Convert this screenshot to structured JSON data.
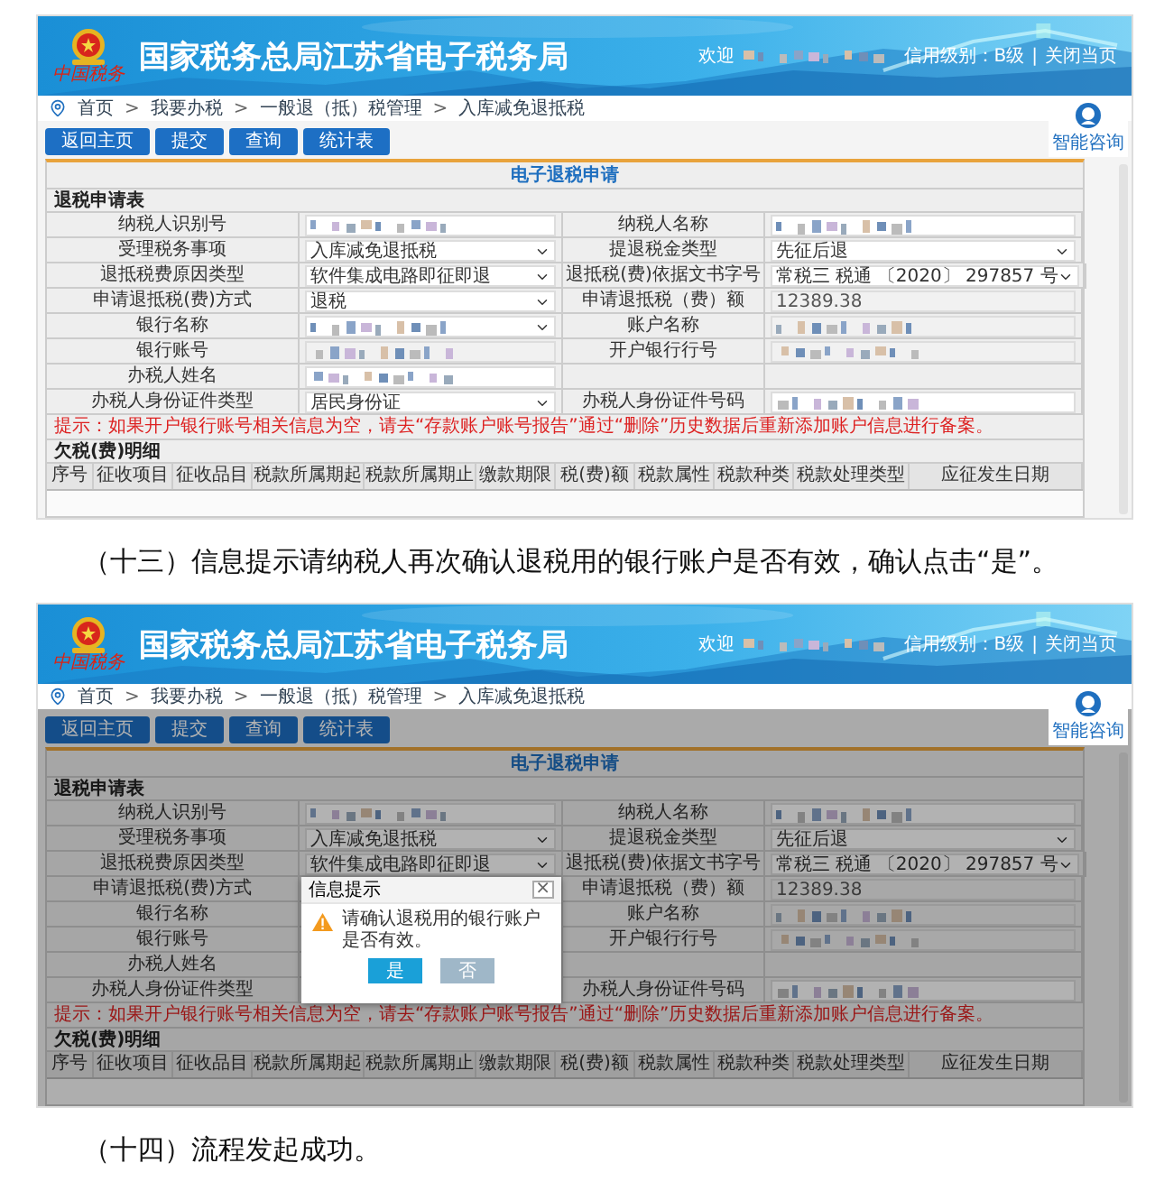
{
  "blocks": [
    {
      "kind": "screen",
      "header": {
        "title": "国家税务总局江苏省电子税务局",
        "logo_caption": "中国税务",
        "welcome": "欢迎",
        "credit": "信用级别：B级",
        "divider": "|",
        "close": "关闭当页"
      },
      "breadcrumb": {
        "separator": ">",
        "items": [
          "首页",
          "我要办税",
          "一般退（抵）税管理",
          "入库减免退抵税"
        ]
      },
      "assistant": "智能咨询",
      "buttons": [
        "返回主页",
        "提交",
        "查询",
        "统计表"
      ],
      "panel_title": "电子退税申请",
      "section_title": "退税申请表",
      "form": [
        {
          "label": "纳税人识别号",
          "field": {
            "kind": "redacted"
          },
          "label2": "纳税人名称",
          "field2": {
            "kind": "redacted"
          }
        },
        {
          "label": "受理税务事项",
          "field": {
            "kind": "select",
            "value": "入库减免退抵税"
          },
          "label2": "提退税金类型",
          "field2": {
            "kind": "select",
            "value": "先征后退"
          }
        },
        {
          "label": "退抵税费原因类型",
          "field": {
            "kind": "select",
            "value": "软件集成电路即征即退"
          },
          "label2": "退抵税(费)依据文书字号",
          "field2": {
            "kind": "select",
            "value": "常税三 税通 〔2020〕 297857 号"
          }
        },
        {
          "label": "申请退抵税(费)方式",
          "field": {
            "kind": "select",
            "value": "退税"
          },
          "label2": "申请退抵税（费）额",
          "field2": {
            "kind": "readonly",
            "value": "12389.38"
          }
        },
        {
          "label": "银行名称",
          "field": {
            "kind": "redacted_select"
          },
          "label2": "账户名称",
          "field2": {
            "kind": "redacted_readonly"
          }
        },
        {
          "label": "银行账号",
          "field": {
            "kind": "redacted_readonly"
          },
          "label2": "开户银行行号",
          "field2": {
            "kind": "redacted_readonly"
          }
        },
        {
          "label": "办税人姓名",
          "field": {
            "kind": "redacted"
          }
        },
        {
          "label": "办税人身份证件类型",
          "field": {
            "kind": "select",
            "value": "居民身份证"
          },
          "label2": "办税人身份证件号码",
          "field2": {
            "kind": "redacted"
          }
        }
      ],
      "hint": "提示：如果开户银行账号相关信息为空，请去“存款账户账号报告”通过“删除”历史数据后重新添加账户信息进行备案。",
      "table_title": "欠税(费)明细",
      "columns": [
        "序号",
        "征收项目",
        "征收品目",
        "税款所属期起",
        "税款所属期止",
        "缴款期限",
        "税(费)额",
        "税款属性",
        "税款种类",
        "税款处理类型",
        "应征发生日期"
      ]
    },
    {
      "kind": "caption",
      "text": "（十三）信息提示请纳税人再次确认退税用的银行账户是否有效，确认点击“是”。"
    },
    {
      "kind": "screen",
      "header": {
        "title": "国家税务总局江苏省电子税务局",
        "logo_caption": "中国税务",
        "welcome": "欢迎",
        "credit": "信用级别：B级",
        "divider": "|",
        "close": "关闭当页"
      },
      "breadcrumb": {
        "separator": ">",
        "items": [
          "首页",
          "我要办税",
          "一般退（抵）税管理",
          "入库减免退抵税"
        ]
      },
      "assistant": "智能咨询",
      "buttons": [
        "返回主页",
        "提交",
        "查询",
        "统计表"
      ],
      "panel_title": "电子退税申请",
      "section_title": "退税申请表",
      "form": [
        {
          "label": "纳税人识别号",
          "field": {
            "kind": "redacted"
          },
          "label2": "纳税人名称",
          "field2": {
            "kind": "redacted"
          }
        },
        {
          "label": "受理税务事项",
          "field": {
            "kind": "select",
            "value": "入库减免退抵税"
          },
          "label2": "提退税金类型",
          "field2": {
            "kind": "select",
            "value": "先征后退"
          }
        },
        {
          "label": "退抵税费原因类型",
          "field": {
            "kind": "select",
            "value": "软件集成电路即征即退"
          },
          "label2": "退抵税(费)依据文书字号",
          "field2": {
            "kind": "select",
            "value": "常税三 税通 〔2020〕 297857 号"
          }
        },
        {
          "label": "申请退抵税(费)方式",
          "label2": "申请退抵税（费）额",
          "field2": {
            "kind": "readonly",
            "value": "12389.38"
          }
        },
        {
          "label": "银行名称",
          "label2": "账户名称",
          "field2": {
            "kind": "redacted_readonly"
          }
        },
        {
          "label": "银行账号",
          "label2": "开户银行行号",
          "field2": {
            "kind": "redacted_readonly"
          }
        },
        {
          "label": "办税人姓名"
        },
        {
          "label": "办税人身份证件类型",
          "label2": "办税人身份证件号码",
          "field2": {
            "kind": "redacted"
          }
        }
      ],
      "hint": "提示：如果开户银行账号相关信息为空，请去“存款账户账号报告”通过“删除”历史数据后重新添加账户信息进行备案。",
      "table_title": "欠税(费)明细",
      "columns": [
        "序号",
        "征收项目",
        "征收品目",
        "税款所属期起",
        "税款所属期止",
        "缴款期限",
        "税(费)额",
        "税款属性",
        "税款种类",
        "税款处理类型",
        "应征发生日期"
      ],
      "dialog": {
        "title": "信息提示",
        "close": "×",
        "message": "请确认退税用的银行账户是否有效。",
        "buttons": [
          {
            "label": "是",
            "kind": "primary"
          },
          {
            "label": "否",
            "kind": "secondary"
          }
        ]
      }
    },
    {
      "kind": "caption",
      "text": "（十四）流程发起成功。"
    }
  ]
}
